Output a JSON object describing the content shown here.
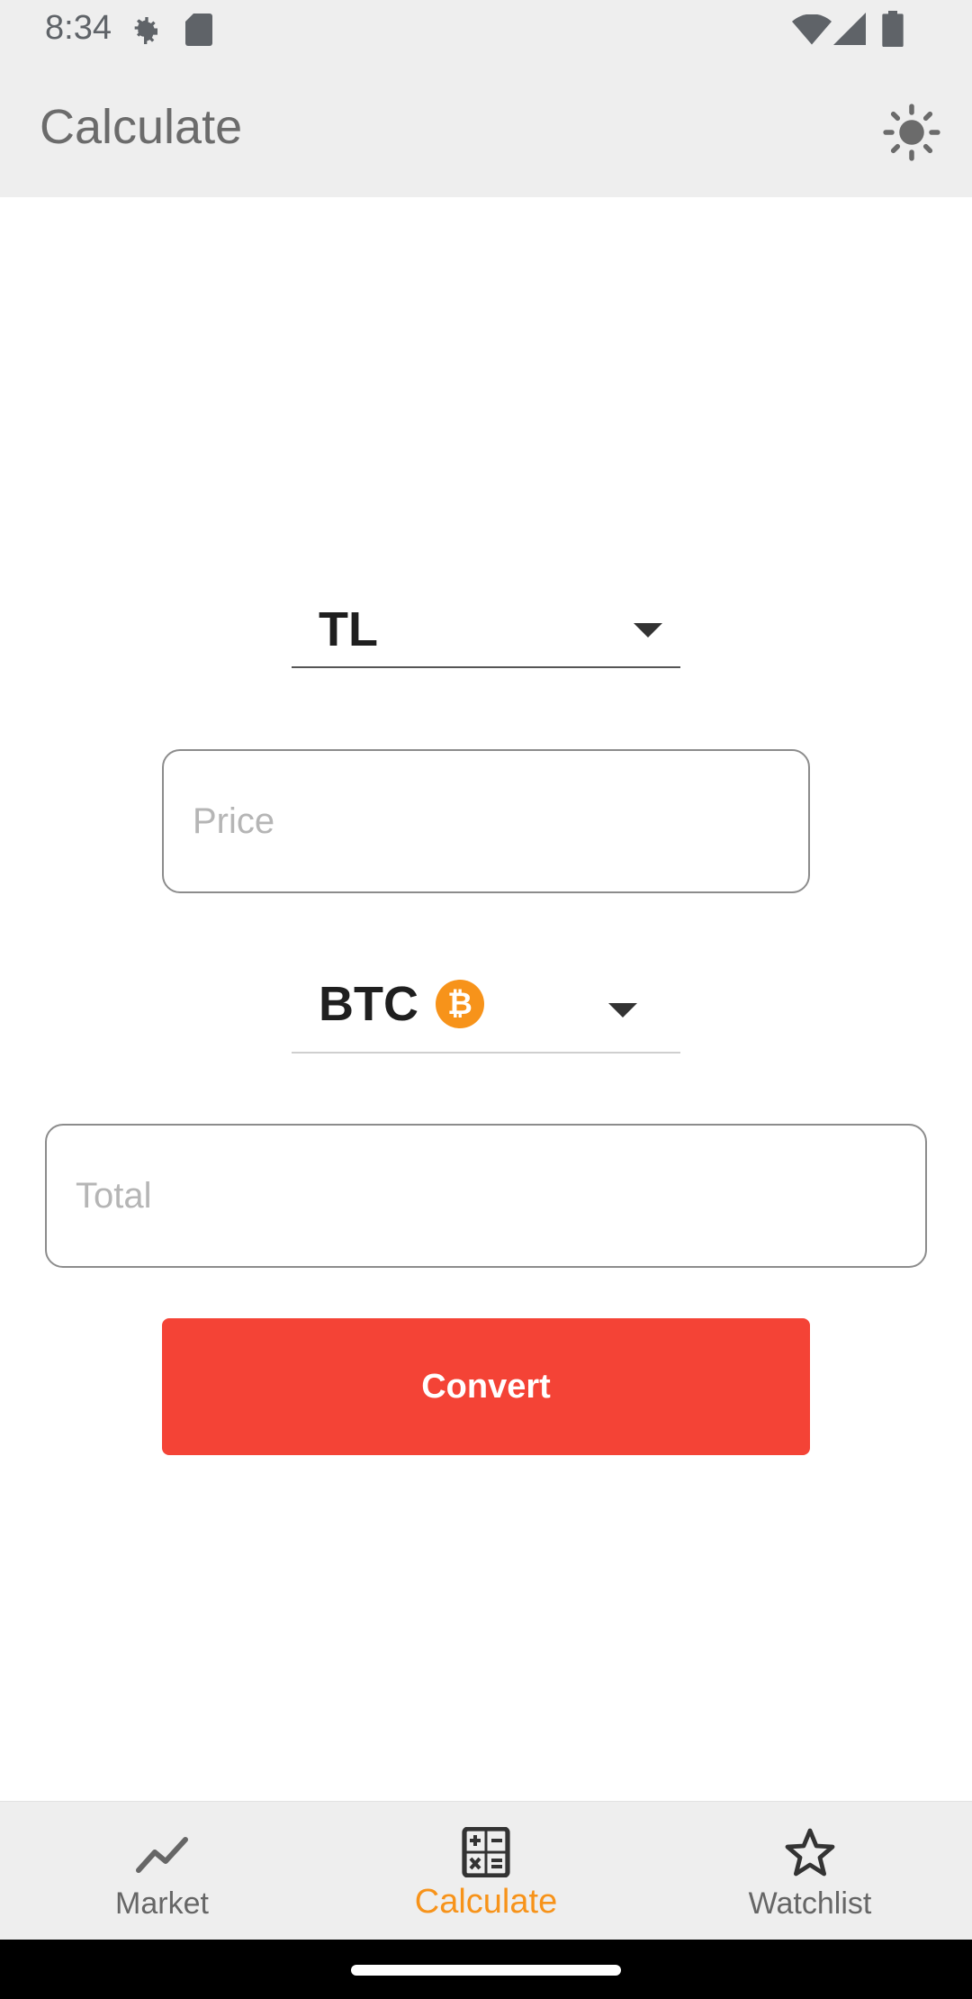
{
  "status_bar": {
    "time": "8:34",
    "icons": [
      "settings-gear-icon",
      "sd-card-icon",
      "wifi-icon",
      "signal-icon",
      "battery-icon"
    ]
  },
  "app_bar": {
    "title": "Calculate",
    "theme_toggle_icon": "sun-icon"
  },
  "form": {
    "from_currency": "TL",
    "price_placeholder": "Price",
    "to_currency": "BTC",
    "to_currency_icon": "bitcoin-icon",
    "total_placeholder": "Total",
    "convert_label": "Convert"
  },
  "bottom_nav": {
    "items": [
      {
        "label": "Market",
        "icon": "trend-line-icon",
        "active": false
      },
      {
        "label": "Calculate",
        "icon": "calculator-icon",
        "active": true
      },
      {
        "label": "Watchlist",
        "icon": "star-icon",
        "active": false
      }
    ]
  },
  "colors": {
    "accent": "#f7931a",
    "convert_button": "#f44336",
    "bar_background": "#eeeeee"
  }
}
